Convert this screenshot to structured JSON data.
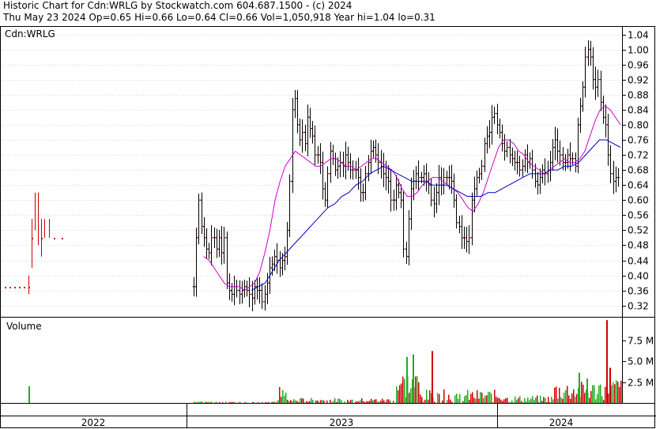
{
  "header": {
    "line1": "Historic Chart for Cdn:WRLG by Stockwatch.com 604.687.1500 - (c) 2024",
    "line2": "Thu May 23 2024  Op=0.65  Hi=0.66  Lo=0.64  Cl=0.66  Vol=1,050,918  Year hi=1.04  lo=0.31"
  },
  "chart_data": {
    "type": "ohlc",
    "symbol_label": "Cdn:WRLG",
    "volume_label": "Volume",
    "price_axis": {
      "ticks": [
        "1.04",
        "1.00",
        "0.96",
        "0.92",
        "0.88",
        "0.84",
        "0.80",
        "0.76",
        "0.72",
        "0.68",
        "0.64",
        "0.60",
        "0.56",
        "0.52",
        "0.48",
        "0.44",
        "0.40",
        "0.36",
        "0.32"
      ],
      "range": [
        0.29,
        1.06
      ]
    },
    "volume_axis": {
      "ticks": [
        {
          "label": "7.5 M",
          "value": 7.5
        },
        {
          "label": "5.0 M",
          "value": 5.0
        },
        {
          "label": "2.5 M",
          "value": 2.5
        }
      ],
      "range": [
        0,
        10.2
      ]
    },
    "years": [
      "2022",
      "2023",
      "2024"
    ],
    "series": {
      "price_bars": [
        0.37,
        0.5,
        0.6,
        0.53,
        0.5,
        0.47,
        0.46,
        0.5,
        0.5,
        0.47,
        0.5,
        0.46,
        0.5,
        0.38,
        0.36,
        0.35,
        0.37,
        0.36,
        0.35,
        0.36,
        0.37,
        0.36,
        0.35,
        0.34,
        0.37,
        0.36,
        0.36,
        0.33,
        0.35,
        0.38,
        0.42,
        0.43,
        0.45,
        0.44,
        0.42,
        0.44,
        0.45,
        0.52,
        0.65,
        0.84,
        0.87,
        0.8,
        0.76,
        0.78,
        0.75,
        0.82,
        0.79,
        0.77,
        0.72,
        0.72,
        0.7,
        0.63,
        0.6,
        0.67,
        0.73,
        0.71,
        0.68,
        0.69,
        0.7,
        0.69,
        0.72,
        0.7,
        0.68,
        0.68,
        0.68,
        0.66,
        0.62,
        0.62,
        0.67,
        0.7,
        0.73,
        0.74,
        0.72,
        0.7,
        0.69,
        0.67,
        0.66,
        0.65,
        0.6,
        0.6,
        0.64,
        0.62,
        0.6,
        0.47,
        0.45,
        0.55,
        0.63,
        0.65,
        0.67,
        0.66,
        0.66,
        0.67,
        0.65,
        0.64,
        0.6,
        0.59,
        0.62,
        0.66,
        0.64,
        0.66,
        0.66,
        0.66,
        0.65,
        0.6,
        0.54,
        0.53,
        0.5,
        0.5,
        0.49,
        0.5,
        0.6,
        0.63,
        0.66,
        0.67,
        0.69,
        0.75,
        0.77,
        0.78,
        0.82,
        0.83,
        0.8,
        0.78,
        0.75,
        0.73,
        0.74,
        0.72,
        0.71,
        0.7,
        0.7,
        0.68,
        0.69,
        0.72,
        0.7,
        0.71,
        0.68,
        0.65,
        0.64,
        0.66,
        0.68,
        0.67,
        0.68,
        0.7,
        0.74,
        0.76,
        0.73,
        0.72,
        0.7,
        0.7,
        0.72,
        0.71,
        0.71,
        0.69,
        0.8,
        0.85,
        0.9,
        0.98,
        1.0,
        0.98,
        0.92,
        0.9,
        0.92,
        0.86,
        0.82,
        0.8,
        0.72,
        0.67,
        0.65,
        0.66,
        0.66
      ],
      "sma_magenta": [
        0.45,
        0.44,
        0.42,
        0.4,
        0.38,
        0.37,
        0.37,
        0.37,
        0.36,
        0.37,
        0.38,
        0.41,
        0.46,
        0.52,
        0.6,
        0.65,
        0.69,
        0.71,
        0.73,
        0.72,
        0.71,
        0.7,
        0.69,
        0.69,
        0.7,
        0.71,
        0.71,
        0.7,
        0.69,
        0.69,
        0.68,
        0.69,
        0.7,
        0.71,
        0.71,
        0.7,
        0.69,
        0.68,
        0.66,
        0.63,
        0.61,
        0.61,
        0.62,
        0.64,
        0.65,
        0.66,
        0.66,
        0.65,
        0.64,
        0.63,
        0.62,
        0.6,
        0.58,
        0.57,
        0.59,
        0.62,
        0.66,
        0.7,
        0.74,
        0.76,
        0.76,
        0.75,
        0.73,
        0.72,
        0.7,
        0.69,
        0.68,
        0.67,
        0.68,
        0.69,
        0.7,
        0.71,
        0.7,
        0.7,
        0.71,
        0.73,
        0.77,
        0.81,
        0.84,
        0.85,
        0.84,
        0.82,
        0.8
      ],
      "sma_blue": [
        0.36,
        0.37,
        0.38,
        0.41,
        0.44,
        0.46,
        0.48,
        0.5,
        0.52,
        0.54,
        0.56,
        0.58,
        0.59,
        0.61,
        0.62,
        0.64,
        0.65,
        0.67,
        0.68,
        0.69,
        0.68,
        0.67,
        0.66,
        0.65,
        0.65,
        0.65,
        0.64,
        0.64,
        0.64,
        0.63,
        0.62,
        0.61,
        0.61,
        0.61,
        0.62,
        0.62,
        0.63,
        0.64,
        0.65,
        0.66,
        0.67,
        0.67,
        0.67,
        0.68,
        0.68,
        0.69,
        0.69,
        0.7,
        0.72,
        0.74,
        0.76,
        0.76,
        0.75,
        0.74
      ],
      "early_2022_dots": [
        0.37,
        0.37,
        0.37,
        0.37,
        0.37,
        0.37,
        0.5,
        0.5,
        0.5,
        0.5
      ]
    },
    "volume_scale": "M"
  }
}
